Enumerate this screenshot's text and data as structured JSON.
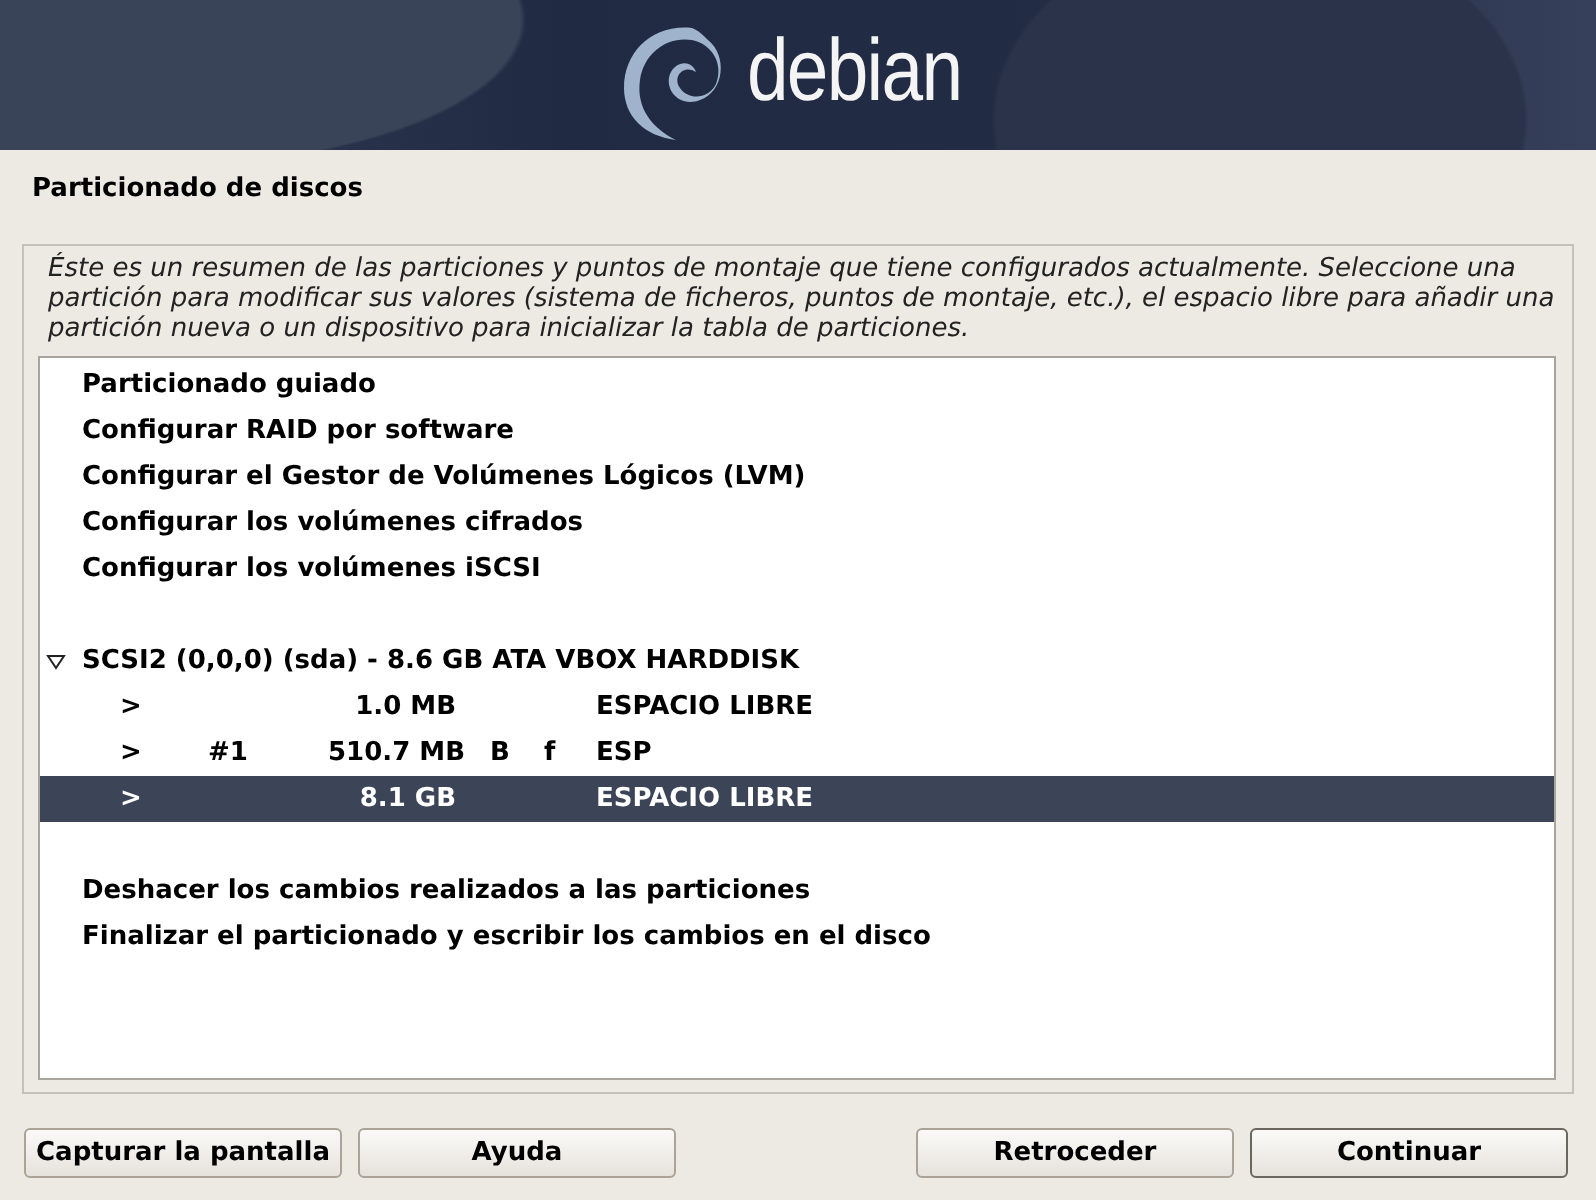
{
  "banner": {
    "logo_text": "debian"
  },
  "page_title": "Particionado de discos",
  "description": "Éste es un resumen de las particiones y puntos de montaje que tiene configurados actualmente. Seleccione una partición para modificar sus valores (sistema de ficheros, puntos de montaje, etc.), el espacio libre para añadir una partición nueva o un dispositivo para inicializar la tabla de particiones.",
  "list": {
    "top_actions": [
      {
        "label": "Particionado guiado",
        "selected": false
      },
      {
        "label": "Configurar RAID por software",
        "selected": false
      },
      {
        "label": "Configurar el Gestor de Volúmenes Lógicos (LVM)",
        "selected": false
      },
      {
        "label": "Configurar los volúmenes cifrados",
        "selected": false
      },
      {
        "label": "Configurar los volúmenes iSCSI",
        "selected": false
      }
    ],
    "disks": [
      {
        "label": "SCSI2 (0,0,0) (sda) - 8.6 GB ATA VBOX HARDDISK",
        "expanded": true,
        "selected": false,
        "children": [
          {
            "arrow": ">",
            "size": "1.0 MB",
            "name": "ESPACIO LIBRE",
            "selected": false
          },
          {
            "arrow": ">",
            "number": "#1",
            "size": "510.7 MB",
            "flag_1": "B",
            "flag_2": "f",
            "name": "ESP",
            "selected": false
          },
          {
            "arrow": ">",
            "size": "8.1 GB",
            "name": "ESPACIO LIBRE",
            "selected": true
          }
        ]
      }
    ],
    "bottom_actions": [
      {
        "label": "Deshacer los cambios realizados a las particiones",
        "selected": false
      },
      {
        "label": "Finalizar el particionado y escribir los cambios en el disco",
        "selected": false
      }
    ]
  },
  "left_buttons": [
    "Capturar la pantalla",
    "Ayuda"
  ],
  "right_buttons": [
    "Retroceder",
    "Continuar"
  ]
}
